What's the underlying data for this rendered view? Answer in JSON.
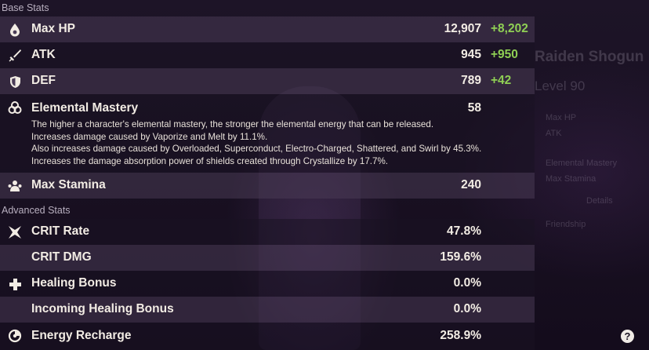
{
  "sections": {
    "base": "Base Stats",
    "advanced": "Advanced Stats"
  },
  "base_stats": [
    {
      "name": "Max HP",
      "icon": "water-drop-icon",
      "value": "12,907",
      "bonus": "+8,202"
    },
    {
      "name": "ATK",
      "icon": "sword-icon",
      "value": "945",
      "bonus": "+950"
    },
    {
      "name": "DEF",
      "icon": "shield-icon",
      "value": "789",
      "bonus": "+42"
    },
    {
      "name": "Elemental Mastery",
      "icon": "elemental-mastery-icon",
      "value": "58",
      "description": [
        "The higher a character's elemental mastery, the stronger the elemental energy that can be released.",
        "Increases damage caused by Vaporize and Melt by 11.1%.",
        "Also increases damage caused by Overloaded, Superconduct, Electro-Charged, Shattered, and Swirl by 45.3%.",
        "Increases the damage absorption power of shields created through Crystallize by 17.7%."
      ]
    },
    {
      "name": "Max Stamina",
      "icon": "stamina-icon",
      "value": "240"
    }
  ],
  "advanced_stats": [
    {
      "name": "CRIT Rate",
      "icon": "crit-icon",
      "value": "47.8%"
    },
    {
      "name": "CRIT DMG",
      "value": "159.6%"
    },
    {
      "name": "Healing Bonus",
      "icon": "plus-icon",
      "value": "0.0%"
    },
    {
      "name": "Incoming Healing Bonus",
      "value": "0.0%"
    },
    {
      "name": "Energy Recharge",
      "icon": "energy-recharge-icon",
      "value": "258.9%"
    }
  ],
  "background": {
    "character_name": "Raiden Shogun",
    "level": "Level 90",
    "stats": [
      "Max HP",
      "ATK",
      "Elemental Mastery",
      "Max Stamina"
    ],
    "details": "Details",
    "friendship": "Friendship"
  },
  "help_label": "?",
  "colors": {
    "bonus": "#8fcf54",
    "band": "#483a54",
    "text": "#f2ece4"
  }
}
